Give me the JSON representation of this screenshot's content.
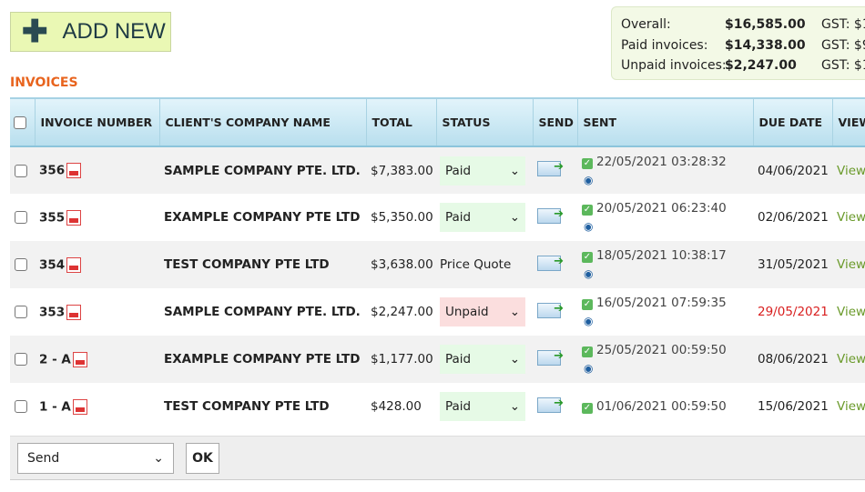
{
  "add_button": "ADD NEW",
  "summary": [
    {
      "label": "Overall:",
      "value": "$16,585.00",
      "gst": "GST: $1"
    },
    {
      "label": "Paid invoices:",
      "value": "$14,338.00",
      "gst": "GST: $9"
    },
    {
      "label": "Unpaid invoices:",
      "value": "$2,247.00",
      "gst": "GST: $1"
    }
  ],
  "section_title": "INVOICES",
  "headers": [
    "INVOICE NUMBER",
    "CLIENT'S COMPANY NAME",
    "TOTAL",
    "STATUS",
    "SEND",
    "SENT",
    "DUE DATE",
    "VIEW"
  ],
  "rows": [
    {
      "number": "356",
      "company": "SAMPLE COMPANY PTE. LTD.",
      "total": "$7,383.00",
      "status": "Paid",
      "sent": "22/05/2021 03:28:32",
      "due": "04/06/2021",
      "view": "View"
    },
    {
      "number": "355",
      "company": "EXAMPLE COMPANY PTE LTD",
      "total": "$5,350.00",
      "status": "Paid",
      "sent": "20/05/2021 06:23:40",
      "due": "02/06/2021",
      "view": "View"
    },
    {
      "number": "354",
      "company": "TEST COMPANY PTE LTD",
      "total": "$3,638.00",
      "status": "Price Quote",
      "sent": "18/05/2021 10:38:17",
      "due": "31/05/2021",
      "view": "View"
    },
    {
      "number": "353",
      "company": "SAMPLE COMPANY PTE. LTD.",
      "total": "$2,247.00",
      "status": "Unpaid",
      "sent": "16/05/2021 07:59:35",
      "due": "29/05/2021",
      "view": "View"
    },
    {
      "number": "2 - A",
      "company": "EXAMPLE COMPANY PTE LTD",
      "total": "$1,177.00",
      "status": "Paid",
      "sent": "25/05/2021 00:59:50",
      "due": "08/06/2021",
      "view": "View"
    },
    {
      "number": "1 - A",
      "company": "TEST COMPANY PTE LTD",
      "total": "$428.00",
      "status": "Paid",
      "sent": "01/06/2021 00:59:50",
      "due": "15/06/2021",
      "view": "View"
    }
  ],
  "footer": {
    "action": "Send",
    "ok": "OK"
  },
  "colors": {
    "accent": "#e8641e",
    "overdue": "#d92020",
    "view": "#6a9a2a"
  }
}
